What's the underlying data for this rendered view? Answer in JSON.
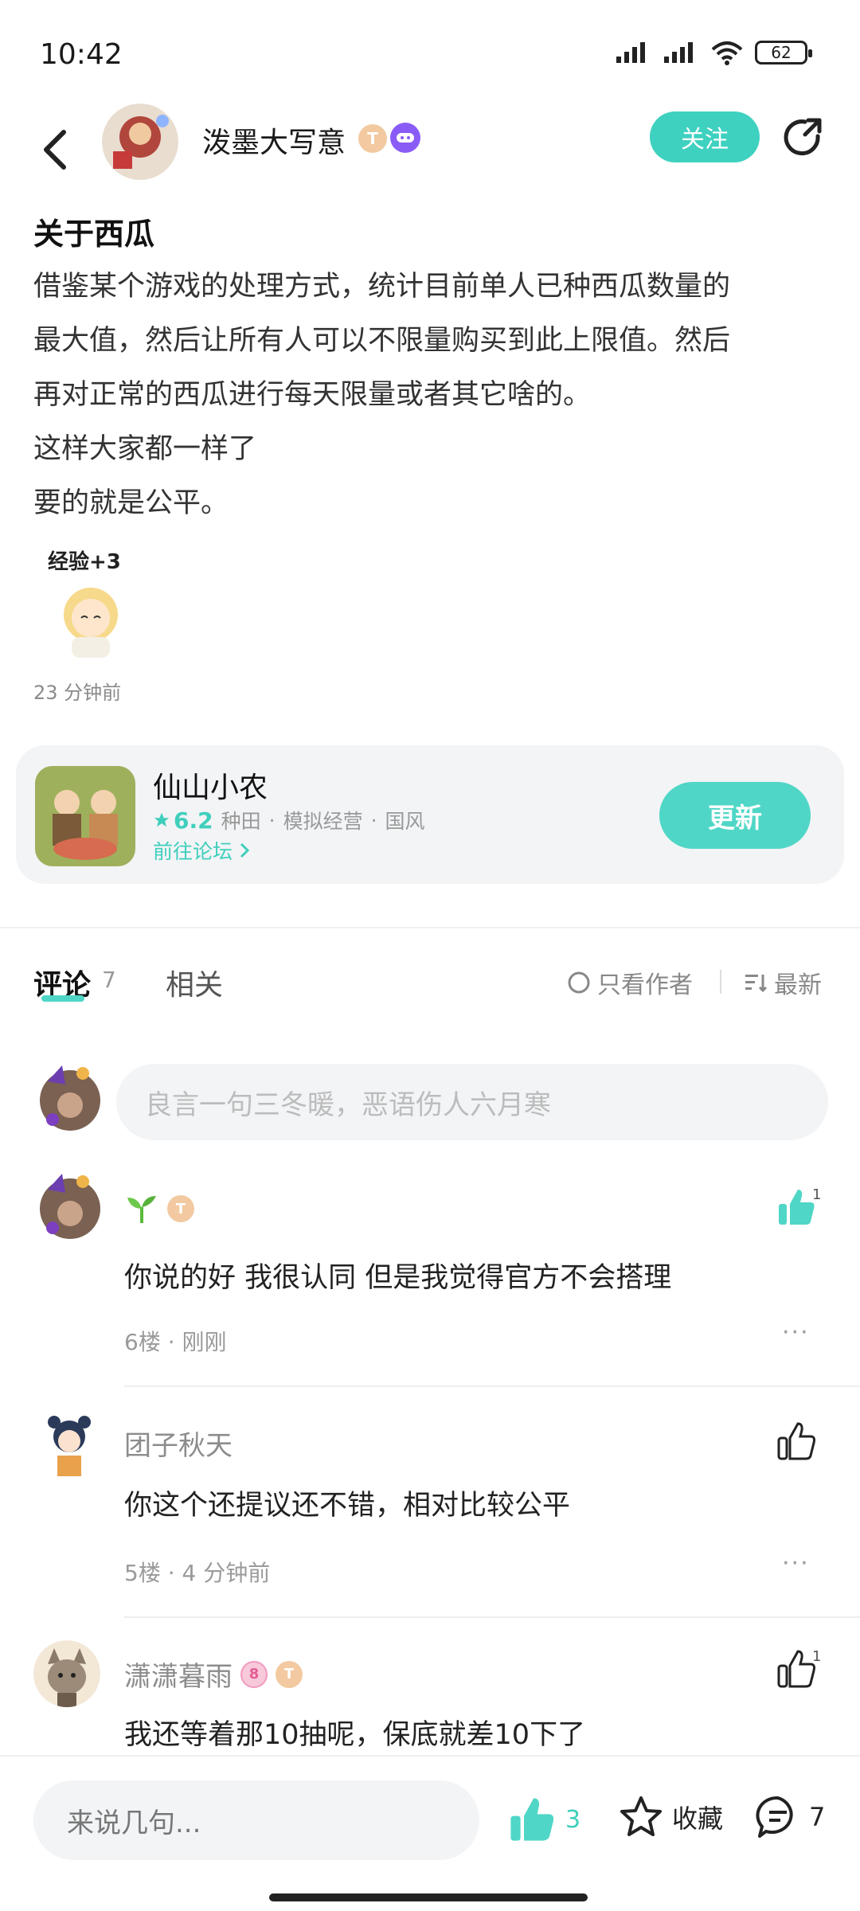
{
  "status_bar": {
    "time": "10:42",
    "battery": "62"
  },
  "header": {
    "author_name": "泼墨大写意",
    "badge_level": "T",
    "follow_label": "关注"
  },
  "post": {
    "title": "关于西瓜",
    "lines": [
      "借鉴某个游戏的处理方式，统计目前单人已种西瓜数量的",
      "最大值，然后让所有人可以不限量购买到此上限值。然后",
      "再对正常的西瓜进行每天限量或者其它啥的。",
      "这样大家都一样了",
      "要的就是公平。"
    ],
    "sticker_text": "经验+3",
    "time": "23 分钟前"
  },
  "game_card": {
    "name": "仙山小农",
    "rating": "6.2",
    "tags": [
      "种田",
      "模拟经营",
      "国风"
    ],
    "forum_link": "前往论坛",
    "update_label": "更新"
  },
  "tabs": {
    "comments_label": "评论",
    "comments_count": "7",
    "related_label": "相关",
    "only_author_label": "只看作者",
    "sort_label": "最新"
  },
  "comment_input": {
    "placeholder": "良言一句三冬暖，恶语伤人六月寒"
  },
  "comments": [
    {
      "name": "",
      "text": "你说的好 我很认同 但是我觉得官方不会搭理",
      "floor": "6楼",
      "time": "刚刚",
      "likes": "1"
    },
    {
      "name": "团子秋天",
      "text": "你这个还提议还不错，相对比较公平",
      "floor": "5楼",
      "time": "4 分钟前",
      "likes": ""
    },
    {
      "name": "潇潇暮雨",
      "text": "我还等着那10抽呢，保底就差10下了",
      "floor": "",
      "time": "",
      "likes": "1"
    }
  ],
  "bottom_bar": {
    "input_placeholder": "来说几句...",
    "like_count": "3",
    "favorite_label": "收藏",
    "comment_count": "7"
  },
  "colors": {
    "accent": "#4fd6c6",
    "muted": "#9a9a9a"
  },
  "icons": [
    "back-icon",
    "share-icon",
    "star-icon",
    "chevron-right-icon",
    "thumbs-up-icon",
    "favorite-star-icon",
    "comment-bubble-icon",
    "more-dots-icon",
    "sort-icon"
  ]
}
